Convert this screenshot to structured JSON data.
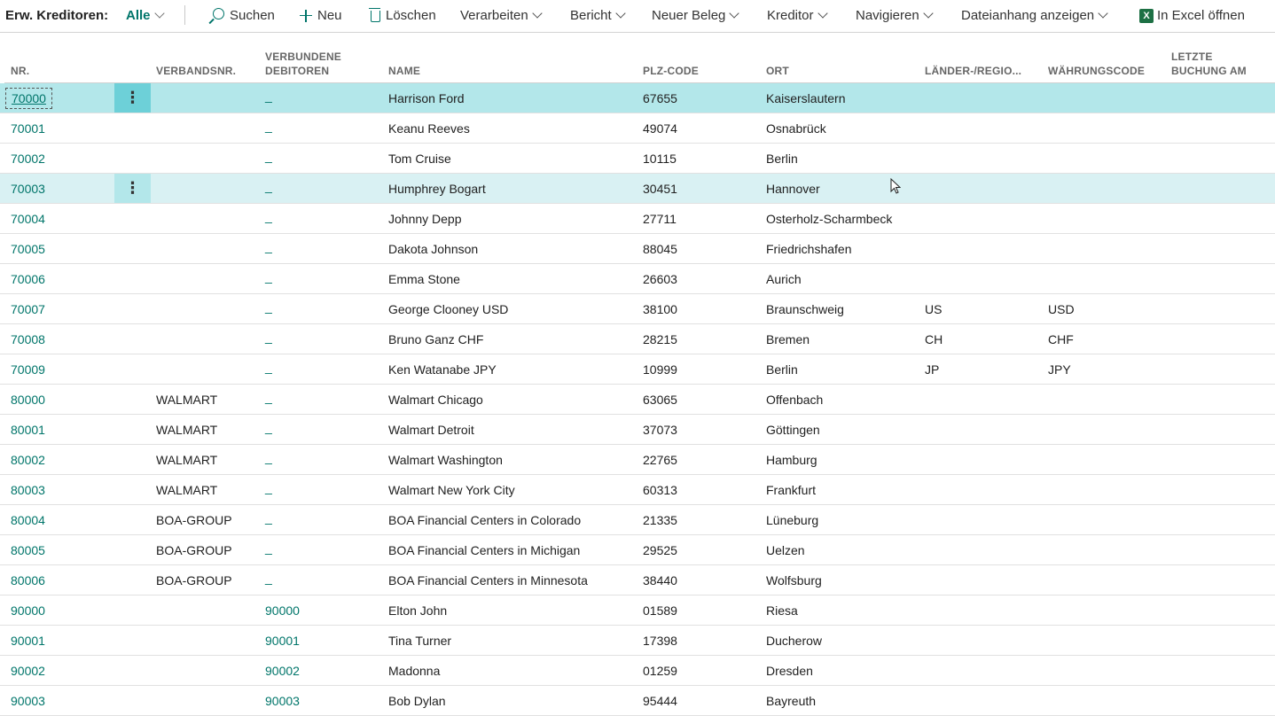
{
  "toolbar": {
    "title": "Erw. Kreditoren:",
    "filter": "Alle",
    "search": "Suchen",
    "new": "Neu",
    "delete": "Löschen",
    "process": "Verarbeiten",
    "report": "Bericht",
    "new_document": "Neuer Beleg",
    "vendor": "Kreditor",
    "navigate": "Navigieren",
    "show_attachments": "Dateianhang anzeigen",
    "open_excel": "In Excel öffnen"
  },
  "columns": {
    "nr": "NR.",
    "verbandsnr": "VERBANDSNR.",
    "debitoren_1": "VERBUNDENE",
    "debitoren_2": "DEBITOREN",
    "name": "NAME",
    "plz": "PLZ-CODE",
    "ort": "ORT",
    "land": "LÄNDER-/REGIO...",
    "waehrung": "WÄHRUNGSCODE",
    "letzte_1": "LETZTE",
    "letzte_2": "BUCHUNG AM"
  },
  "rows": [
    {
      "nr": "70000",
      "verband": "",
      "debitor": "_",
      "name": "Harrison Ford",
      "plz": "67655",
      "ort": "Kaiserslautern",
      "land": "",
      "waehrung": "",
      "state": "selected"
    },
    {
      "nr": "70001",
      "verband": "",
      "debitor": "_",
      "name": "Keanu Reeves",
      "plz": "49074",
      "ort": "Osnabrück",
      "land": "",
      "waehrung": "",
      "state": ""
    },
    {
      "nr": "70002",
      "verband": "",
      "debitor": "_",
      "name": "Tom Cruise",
      "plz": "10115",
      "ort": "Berlin",
      "land": "",
      "waehrung": "",
      "state": ""
    },
    {
      "nr": "70003",
      "verband": "",
      "debitor": "_",
      "name": "Humphrey Bogart",
      "plz": "30451",
      "ort": "Hannover",
      "land": "",
      "waehrung": "",
      "state": "hover"
    },
    {
      "nr": "70004",
      "verband": "",
      "debitor": "_",
      "name": "Johnny Depp",
      "plz": "27711",
      "ort": "Osterholz-Scharmbeck",
      "land": "",
      "waehrung": "",
      "state": ""
    },
    {
      "nr": "70005",
      "verband": "",
      "debitor": "_",
      "name": "Dakota Johnson",
      "plz": "88045",
      "ort": "Friedrichshafen",
      "land": "",
      "waehrung": "",
      "state": ""
    },
    {
      "nr": "70006",
      "verband": "",
      "debitor": "_",
      "name": "Emma Stone",
      "plz": "26603",
      "ort": "Aurich",
      "land": "",
      "waehrung": "",
      "state": ""
    },
    {
      "nr": "70007",
      "verband": "",
      "debitor": "_",
      "name": "George Clooney USD",
      "plz": "38100",
      "ort": "Braunschweig",
      "land": "US",
      "waehrung": "USD",
      "state": ""
    },
    {
      "nr": "70008",
      "verband": "",
      "debitor": "_",
      "name": "Bruno Ganz CHF",
      "plz": "28215",
      "ort": "Bremen",
      "land": "CH",
      "waehrung": "CHF",
      "state": ""
    },
    {
      "nr": "70009",
      "verband": "",
      "debitor": "_",
      "name": "Ken Watanabe JPY",
      "plz": "10999",
      "ort": "Berlin",
      "land": "JP",
      "waehrung": "JPY",
      "state": ""
    },
    {
      "nr": "80000",
      "verband": "WALMART",
      "debitor": "_",
      "name": "Walmart Chicago",
      "plz": "63065",
      "ort": "Offenbach",
      "land": "",
      "waehrung": "",
      "state": ""
    },
    {
      "nr": "80001",
      "verband": "WALMART",
      "debitor": "_",
      "name": "Walmart Detroit",
      "plz": "37073",
      "ort": "Göttingen",
      "land": "",
      "waehrung": "",
      "state": ""
    },
    {
      "nr": "80002",
      "verband": "WALMART",
      "debitor": "_",
      "name": "Walmart Washington",
      "plz": "22765",
      "ort": "Hamburg",
      "land": "",
      "waehrung": "",
      "state": ""
    },
    {
      "nr": "80003",
      "verband": "WALMART",
      "debitor": "_",
      "name": "Walmart New York City",
      "plz": "60313",
      "ort": "Frankfurt",
      "land": "",
      "waehrung": "",
      "state": ""
    },
    {
      "nr": "80004",
      "verband": "BOA-GROUP",
      "debitor": "_",
      "name": "BOA Financial Centers in Colorado",
      "plz": "21335",
      "ort": "Lüneburg",
      "land": "",
      "waehrung": "",
      "state": ""
    },
    {
      "nr": "80005",
      "verband": "BOA-GROUP",
      "debitor": "_",
      "name": "BOA Financial Centers in Michigan",
      "plz": "29525",
      "ort": "Uelzen",
      "land": "",
      "waehrung": "",
      "state": ""
    },
    {
      "nr": "80006",
      "verband": "BOA-GROUP",
      "debitor": "_",
      "name": "BOA Financial Centers in Minnesota",
      "plz": "38440",
      "ort": "Wolfsburg",
      "land": "",
      "waehrung": "",
      "state": ""
    },
    {
      "nr": "90000",
      "verband": "",
      "debitor": "90000",
      "name": "Elton John",
      "plz": "01589",
      "ort": "Riesa",
      "land": "",
      "waehrung": "",
      "state": ""
    },
    {
      "nr": "90001",
      "verband": "",
      "debitor": "90001",
      "name": "Tina Turner",
      "plz": "17398",
      "ort": "Ducherow",
      "land": "",
      "waehrung": "",
      "state": ""
    },
    {
      "nr": "90002",
      "verband": "",
      "debitor": "90002",
      "name": "Madonna",
      "plz": "01259",
      "ort": "Dresden",
      "land": "",
      "waehrung": "",
      "state": ""
    },
    {
      "nr": "90003",
      "verband": "",
      "debitor": "90003",
      "name": "Bob Dylan",
      "plz": "95444",
      "ort": "Bayreuth",
      "land": "",
      "waehrung": "",
      "state": ""
    }
  ]
}
